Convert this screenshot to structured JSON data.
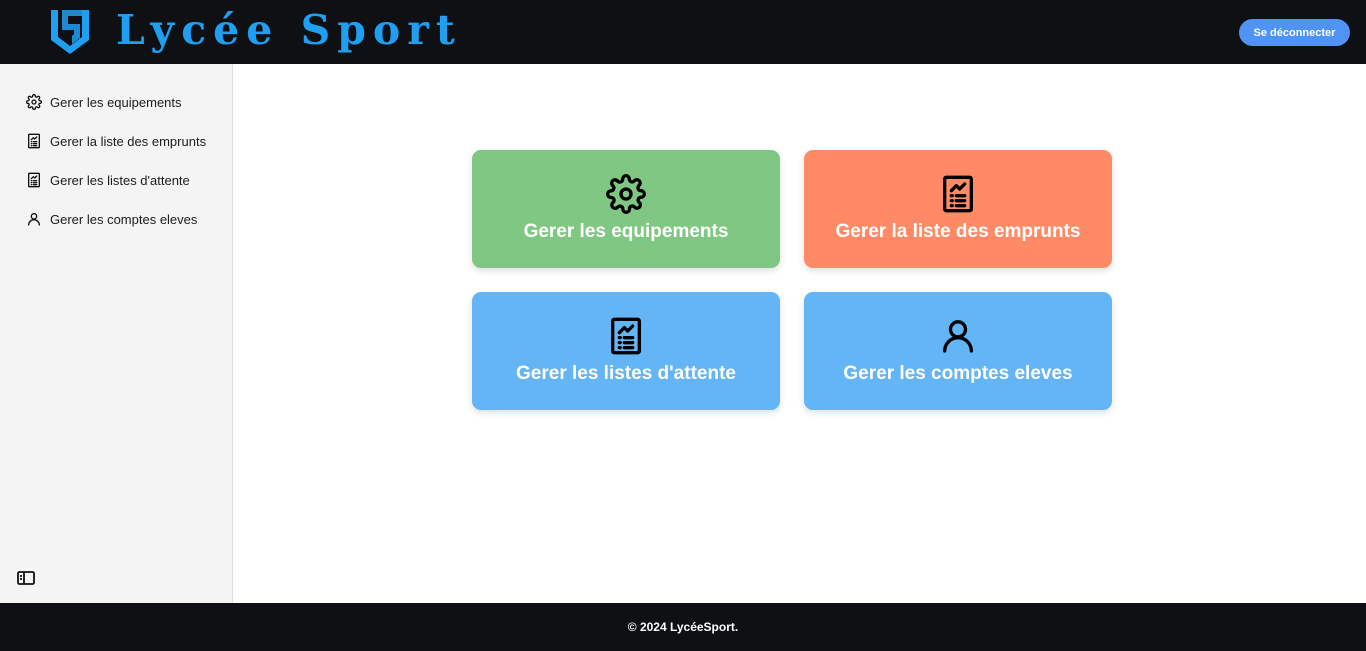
{
  "header": {
    "brand": "Lycée Sport",
    "logout_label": "Se déconnecter",
    "brand_color": "#1e9ff2",
    "logout_color": "#4f93f7"
  },
  "sidebar": {
    "items": [
      {
        "label": "Gerer les equipements",
        "icon": "gear-icon"
      },
      {
        "label": "Gerer la liste des emprunts",
        "icon": "report-icon"
      },
      {
        "label": "Gerer les listes d'attente",
        "icon": "report-icon"
      },
      {
        "label": "Gerer les comptes eleves",
        "icon": "user-icon"
      }
    ],
    "toggle_icon": "sidebar-toggle-icon"
  },
  "cards": [
    {
      "label": "Gerer les equipements",
      "icon": "gear-icon",
      "color": "#81c784"
    },
    {
      "label": "Gerer la liste des emprunts",
      "icon": "report-icon",
      "color": "#ff8a65"
    },
    {
      "label": "Gerer les listes d'attente",
      "icon": "report-icon",
      "color": "#64b5f6"
    },
    {
      "label": "Gerer les comptes eleves",
      "icon": "user-icon",
      "color": "#64b5f6"
    }
  ],
  "footer": {
    "text": "© 2024 LycéeSport."
  }
}
